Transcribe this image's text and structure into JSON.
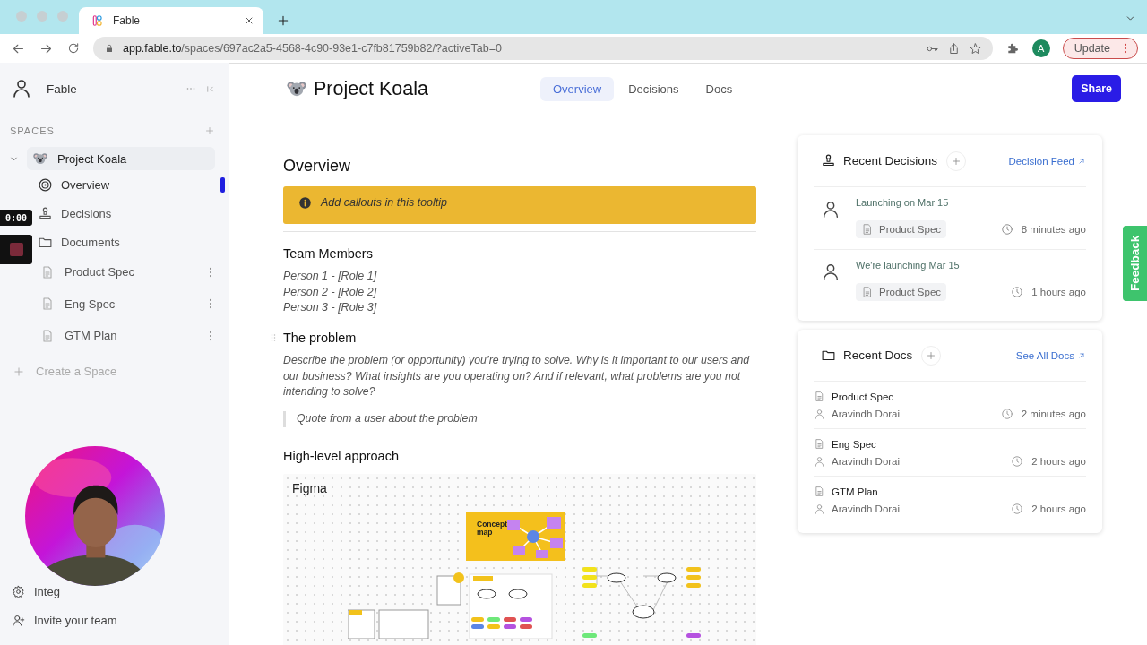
{
  "browser": {
    "tab_title": "Fable",
    "url_host": "app.fable.to",
    "url_path": "/spaces/697ac2a5-4568-4c90-93e1-c7fb81759b82/?activeTab=0",
    "profile_initial": "A",
    "update_label": "Update"
  },
  "sidebar": {
    "workspace": "Fable",
    "section_label": "SPACES",
    "space": {
      "name": "Project Koala",
      "expanded": true
    },
    "items": [
      {
        "label": "Overview",
        "kind": "overview",
        "selected": true
      },
      {
        "label": "Decisions",
        "kind": "decisions",
        "selected": false
      },
      {
        "label": "Documents",
        "kind": "folder",
        "selected": false,
        "children": [
          {
            "label": "Product Spec"
          },
          {
            "label": "Eng Spec"
          },
          {
            "label": "GTM Plan"
          }
        ]
      }
    ],
    "create_label": "Create a Space",
    "footer": [
      {
        "label": "Integ",
        "kind": "integrations"
      },
      {
        "label": "Invite your team",
        "kind": "invite"
      }
    ]
  },
  "recorder": {
    "time": "0:00"
  },
  "header": {
    "title": "Project Koala",
    "tabs": [
      {
        "label": "Overview",
        "selected": true
      },
      {
        "label": "Decisions",
        "selected": false
      },
      {
        "label": "Docs",
        "selected": false
      }
    ],
    "share_label": "Share"
  },
  "document": {
    "heading": "Overview",
    "callout": "Add callouts in this tooltip",
    "sections": [
      {
        "kind": "list",
        "title": "Team Members",
        "lines": [
          "Person 1 - [Role 1]",
          "Person 2 - [Role 2]",
          "Person 3 - [Role 3]"
        ]
      },
      {
        "kind": "problem",
        "title": "The problem",
        "paragraph": "Describe the problem (or opportunity) you’re trying to solve. Why is it important to our users and our business? What insights are you operating on? And if relevant, what problems are you not intending to solve?",
        "quote": "Quote from a user about the problem"
      },
      {
        "kind": "embed",
        "title": "High-level approach",
        "embed": {
          "label": "Figma",
          "card_title": "Concept map"
        }
      }
    ]
  },
  "decisions_panel": {
    "title": "Recent Decisions",
    "link": "Decision Feed",
    "items": [
      {
        "text": "Launching on Mar 15",
        "doc": "Product Spec",
        "time": "8 minutes ago"
      },
      {
        "text": "We're launching Mar 15",
        "doc": "Product Spec",
        "time": "1 hours ago"
      }
    ]
  },
  "docs_panel": {
    "title": "Recent Docs",
    "link": "See All Docs",
    "items": [
      {
        "title": "Product Spec",
        "author": "Aravindh Dorai",
        "time": "2 minutes ago"
      },
      {
        "title": "Eng Spec",
        "author": "Aravindh Dorai",
        "time": "2 hours ago"
      },
      {
        "title": "GTM Plan",
        "author": "Aravindh Dorai",
        "time": "2 hours ago"
      }
    ]
  },
  "feedback_label": "Feedback"
}
